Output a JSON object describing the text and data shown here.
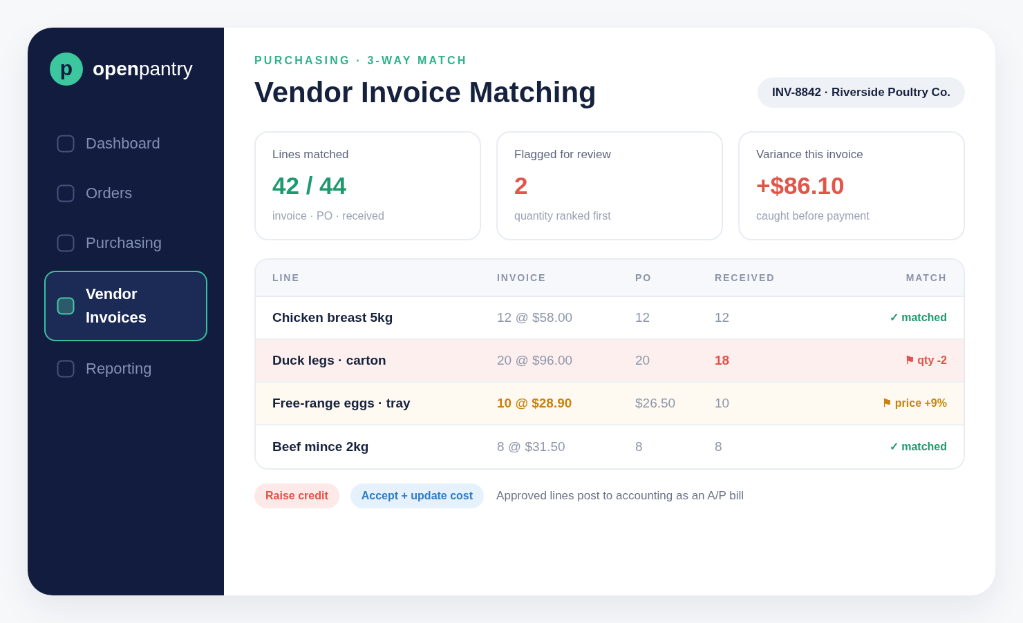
{
  "sidebar": {
    "logo": {
      "mark": "p",
      "name": "**open**pantry"
    },
    "nav": [
      {
        "label": "Dashboard",
        "selected": false
      },
      {
        "label": "Orders",
        "selected": false
      },
      {
        "label": "Purchasing",
        "selected": false
      },
      {
        "label": "Vendor Invoices",
        "selected": true
      },
      {
        "label": "Reporting",
        "selected": false
      }
    ]
  },
  "header": {
    "eyebrow": "PURCHASING · 3-WAY MATCH",
    "title": "Vendor Invoice Matching",
    "invoice_badge": "INV-8842 · Riverside Poultry Co."
  },
  "stats": [
    {
      "label": "Lines matched",
      "value": "42 / 44",
      "caption": "invoice · PO · received",
      "color": "#1e9a6e"
    },
    {
      "label": "Flagged for review",
      "value": "2",
      "caption": "quantity ranked first",
      "color": "#e0564a"
    },
    {
      "label": "Variance this invoice",
      "value": "+$86.10",
      "caption": "caught before payment",
      "color": "#e0564a"
    }
  ],
  "table": {
    "columns": [
      "LINE",
      "INVOICE",
      "PO",
      "RECEIVED",
      "MATCH"
    ],
    "rows": [
      {
        "kind": "matched",
        "line": "Chicken breast 5kg",
        "values": [
          {
            "text": "12 @ $58.00",
            "flagged": false
          },
          {
            "text": "12",
            "flagged": false
          },
          {
            "text": "12",
            "flagged": false
          }
        ],
        "match": "✓ matched"
      },
      {
        "kind": "quantity",
        "line": "Duck legs · carton",
        "values": [
          {
            "text": "20 @ $96.00",
            "flagged": false
          },
          {
            "text": "20",
            "flagged": false
          },
          {
            "text": "18",
            "flagged": true
          }
        ],
        "match": "⚑ qty -2"
      },
      {
        "kind": "price",
        "line": "Free-range eggs · tray",
        "values": [
          {
            "text": "10 @ $28.90",
            "flagged": true
          },
          {
            "text": "$26.50",
            "flagged": false
          },
          {
            "text": "10",
            "flagged": false
          }
        ],
        "match": "⚑ price +9%"
      },
      {
        "kind": "matched",
        "line": "Beef mince 2kg",
        "values": [
          {
            "text": "8 @ $31.50",
            "flagged": false
          },
          {
            "text": "8",
            "flagged": false
          },
          {
            "text": "8",
            "flagged": false
          }
        ],
        "match": "✓ matched"
      }
    ]
  },
  "actions": [
    {
      "label": "Raise credit",
      "kind": "danger"
    },
    {
      "label": "Accept + update cost",
      "kind": "primary"
    }
  ],
  "note": "Approved lines post to accounting as an A/P bill"
}
